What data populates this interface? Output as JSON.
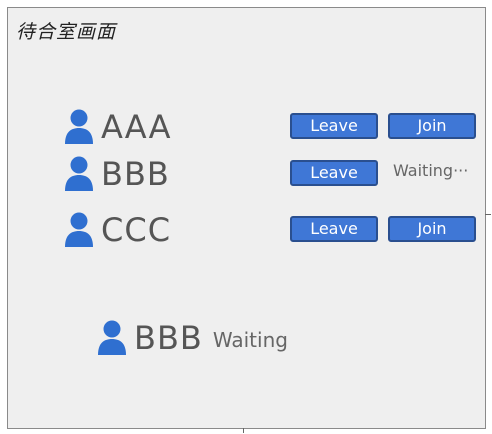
{
  "window": {
    "title": "待合室画面"
  },
  "rows": [
    {
      "name": "AAA",
      "leave_label": "Leave",
      "join_label": "Join"
    },
    {
      "name": "BBB",
      "leave_label": "Leave",
      "status": "Waiting···"
    },
    {
      "name": "CCC",
      "leave_label": "Leave",
      "join_label": "Join"
    }
  ],
  "current_user": {
    "name": "BBB",
    "status": "Waiting"
  },
  "icons": {
    "user": "person-icon"
  },
  "colors": {
    "button_fill": "#3f77d6",
    "icon_fill": "#2f6fd0",
    "panel_bg": "#efefef"
  }
}
